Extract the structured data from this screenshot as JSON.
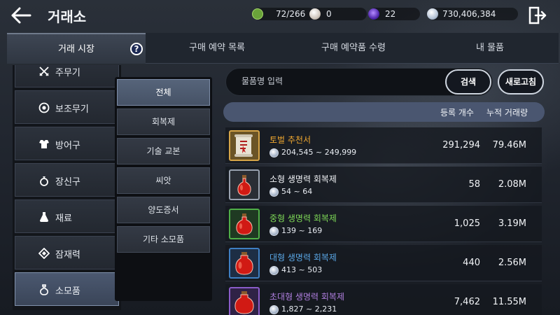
{
  "header": {
    "title": "거래소"
  },
  "resources": [
    {
      "name": "energy",
      "value": "72/266",
      "color": "#7bc043",
      "icon": "leaf-energy-icon"
    },
    {
      "name": "pearl",
      "value": "0",
      "color": "#d9d2cc",
      "icon": "pearl-icon"
    },
    {
      "name": "crystal",
      "value": "22",
      "color": "#6a3fd0",
      "icon": "crystal-icon"
    },
    {
      "name": "silver",
      "value": "730,406,384",
      "color": "#c7d3e3",
      "icon": "silver-coin-icon"
    }
  ],
  "tabs": [
    {
      "label": "거래 시장",
      "active": true
    },
    {
      "label": "구매 예약 목록",
      "active": false
    },
    {
      "label": "구매 예약품 수령",
      "active": false
    },
    {
      "label": "내 물품",
      "active": false
    }
  ],
  "help_label": "?",
  "categories": [
    {
      "label": "주무기",
      "icon": "crossed-swords-icon"
    },
    {
      "label": "보조무기",
      "icon": "shield-ring-icon"
    },
    {
      "label": "방어구",
      "icon": "armor-icon"
    },
    {
      "label": "장신구",
      "icon": "ring-icon"
    },
    {
      "label": "재료",
      "icon": "flask-icon"
    },
    {
      "label": "잠재력",
      "icon": "diamond-icon"
    },
    {
      "label": "소모품",
      "icon": "potion-icon",
      "active": true
    }
  ],
  "subcategories": [
    {
      "label": "전체",
      "active": true
    },
    {
      "label": "회복제"
    },
    {
      "label": "기술 교본"
    },
    {
      "label": "씨앗"
    },
    {
      "label": "양도증서"
    },
    {
      "label": "기타 소모품"
    }
  ],
  "search": {
    "placeholder": "물품명 입력",
    "button": "검색",
    "refresh": "새로고침"
  },
  "table": {
    "headers": {
      "registered": "등록 개수",
      "volume": "누적 거래량"
    },
    "rows": [
      {
        "name": "토벌 추천서",
        "name_color": "#f0a830",
        "price": "204,545 ~ 249,999",
        "registered": "291,294",
        "volume": "79.46M",
        "icon": "scroll-icon",
        "frame": "#d6a548"
      },
      {
        "name": "소형 생명력 회복제",
        "name_color": "#f2f4f7",
        "price": "54 ~ 64",
        "registered": "58",
        "volume": "2.08M",
        "icon": "small-red-potion-icon",
        "frame": "#9aa3b0"
      },
      {
        "name": "중형 생명력 회복제",
        "name_color": "#7ed957",
        "price": "139 ~ 169",
        "registered": "1,025",
        "volume": "3.19M",
        "icon": "medium-red-potion-icon",
        "frame": "#4fae48"
      },
      {
        "name": "대형 생명력 회복제",
        "name_color": "#5aa7e6",
        "price": "413 ~ 503",
        "registered": "440",
        "volume": "2.56M",
        "icon": "large-red-potion-icon",
        "frame": "#3f7fc2"
      },
      {
        "name": "초대형 생명력 회복제",
        "name_color": "#b07fe0",
        "price": "1,827 ~ 2,231",
        "registered": "7,462",
        "volume": "11.55M",
        "icon": "xl-red-potion-icon",
        "frame": "#8a5cc9"
      }
    ]
  }
}
